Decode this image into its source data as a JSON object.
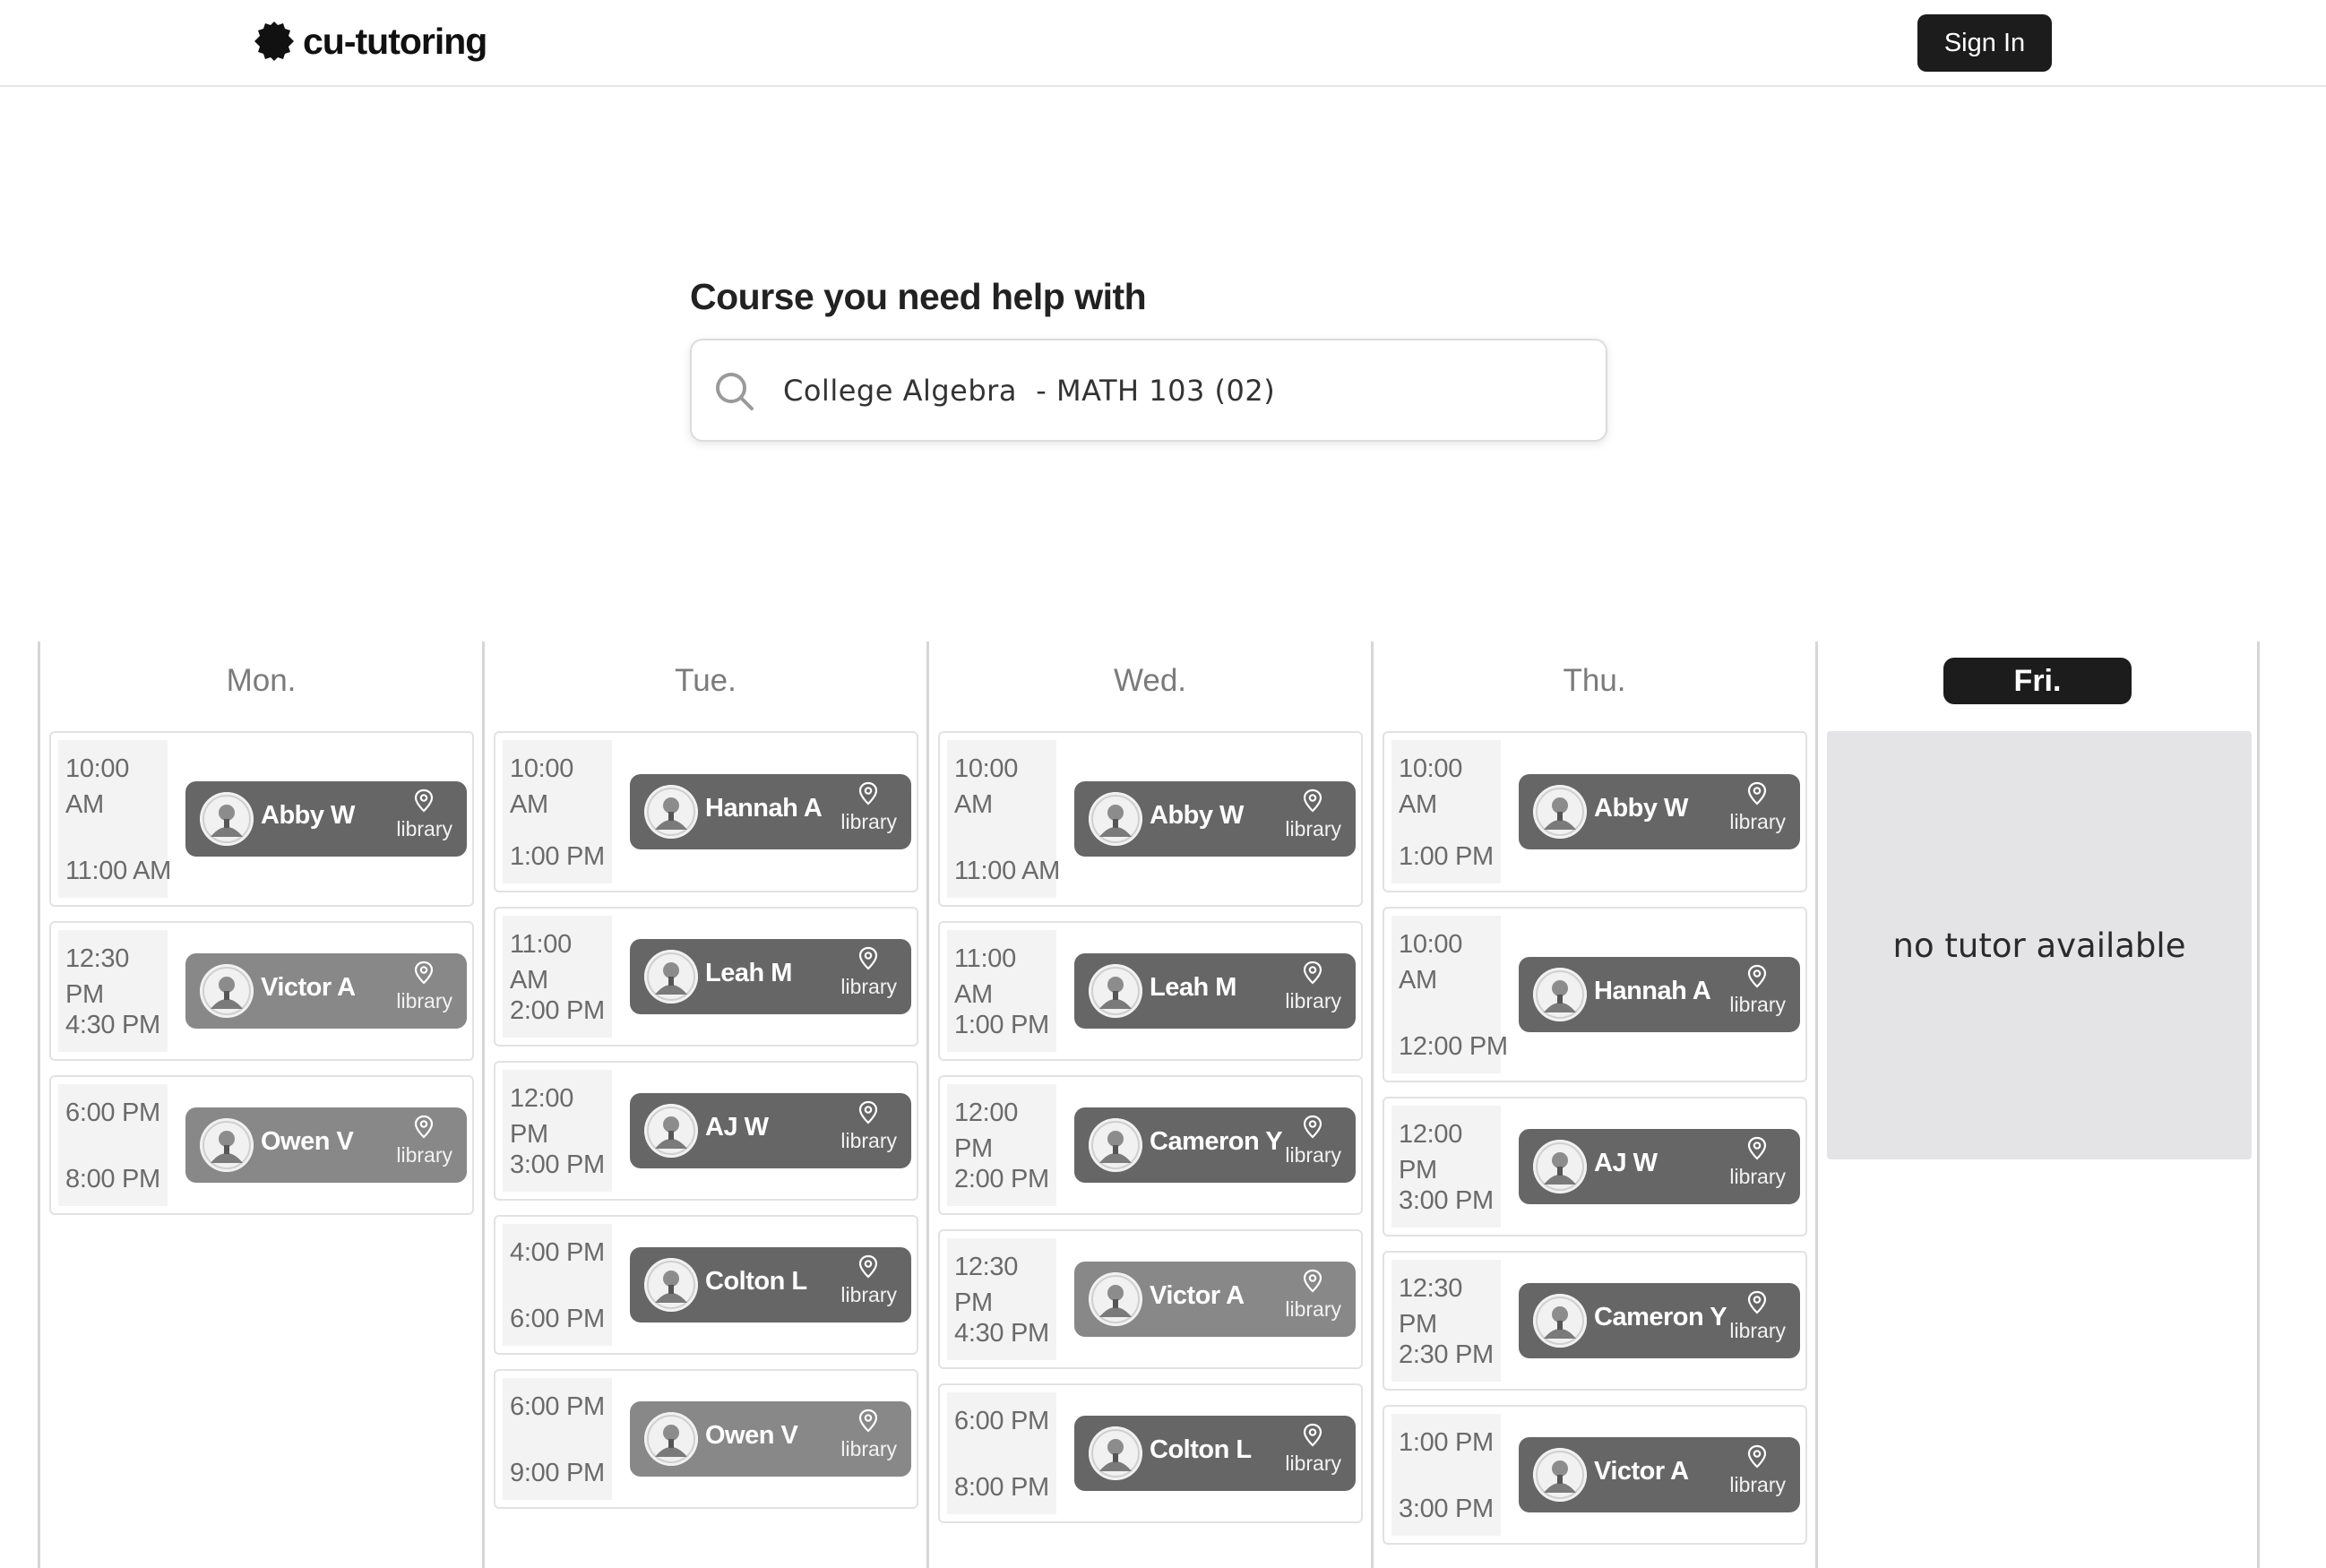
{
  "header": {
    "brand": "cu-tutoring",
    "sign_in": "Sign In"
  },
  "search": {
    "label": "Course you need help with",
    "value": "College Algebra  - MATH 103 (02)",
    "icon": "search-icon"
  },
  "colors": {
    "tutor_dark": "#666666",
    "tutor_light": "#888888",
    "active_day": "#1c1c1c",
    "no_tutor_bg": "#e4e4e6"
  },
  "days": [
    {
      "name": "Mon.",
      "slots": [
        {
          "start": "10:00 AM",
          "end": "11:00 AM",
          "tutor": "Abby W",
          "location": "library",
          "shade": "dark"
        },
        {
          "start": "12:30 PM",
          "end": "4:30 PM",
          "tutor": "Victor A",
          "location": "library",
          "shade": "light"
        },
        {
          "start": "6:00 PM",
          "end": "8:00 PM",
          "tutor": "Owen V",
          "location": "library",
          "shade": "light"
        }
      ]
    },
    {
      "name": "Tue.",
      "slots": [
        {
          "start": "10:00 AM",
          "end": "1:00 PM",
          "tutor": "Hannah A",
          "location": "library",
          "shade": "dark"
        },
        {
          "start": "11:00 AM",
          "end": "2:00 PM",
          "tutor": "Leah M",
          "location": "library",
          "shade": "dark"
        },
        {
          "start": "12:00 PM",
          "end": "3:00 PM",
          "tutor": "AJ W",
          "location": "library",
          "shade": "dark"
        },
        {
          "start": "4:00 PM",
          "end": "6:00 PM",
          "tutor": "Colton L",
          "location": "library",
          "shade": "dark"
        },
        {
          "start": "6:00 PM",
          "end": "9:00 PM",
          "tutor": "Owen V",
          "location": "library",
          "shade": "light"
        }
      ]
    },
    {
      "name": "Wed.",
      "slots": [
        {
          "start": "10:00 AM",
          "end": "11:00 AM",
          "tutor": "Abby W",
          "location": "library",
          "shade": "dark"
        },
        {
          "start": "11:00 AM",
          "end": "1:00 PM",
          "tutor": "Leah M",
          "location": "library",
          "shade": "dark"
        },
        {
          "start": "12:00 PM",
          "end": "2:00 PM",
          "tutor": "Cameron Y",
          "location": "library",
          "shade": "dark"
        },
        {
          "start": "12:30 PM",
          "end": "4:30 PM",
          "tutor": "Victor A",
          "location": "library",
          "shade": "light"
        },
        {
          "start": "6:00 PM",
          "end": "8:00 PM",
          "tutor": "Colton L",
          "location": "library",
          "shade": "dark"
        }
      ]
    },
    {
      "name": "Thu.",
      "slots": [
        {
          "start": "10:00 AM",
          "end": "1:00 PM",
          "tutor": "Abby W",
          "location": "library",
          "shade": "dark"
        },
        {
          "start": "10:00 AM",
          "end": "12:00 PM",
          "tutor": "Hannah A",
          "location": "library",
          "shade": "dark"
        },
        {
          "start": "12:00 PM",
          "end": "3:00 PM",
          "tutor": "AJ W",
          "location": "library",
          "shade": "dark"
        },
        {
          "start": "12:30 PM",
          "end": "2:30 PM",
          "tutor": "Cameron Y",
          "location": "library",
          "shade": "dark"
        },
        {
          "start": "1:00 PM",
          "end": "3:00 PM",
          "tutor": "Victor A",
          "location": "library",
          "shade": "dark"
        }
      ]
    },
    {
      "name": "Fri.",
      "active": true,
      "slots": [],
      "empty_message": "no tutor available"
    }
  ]
}
